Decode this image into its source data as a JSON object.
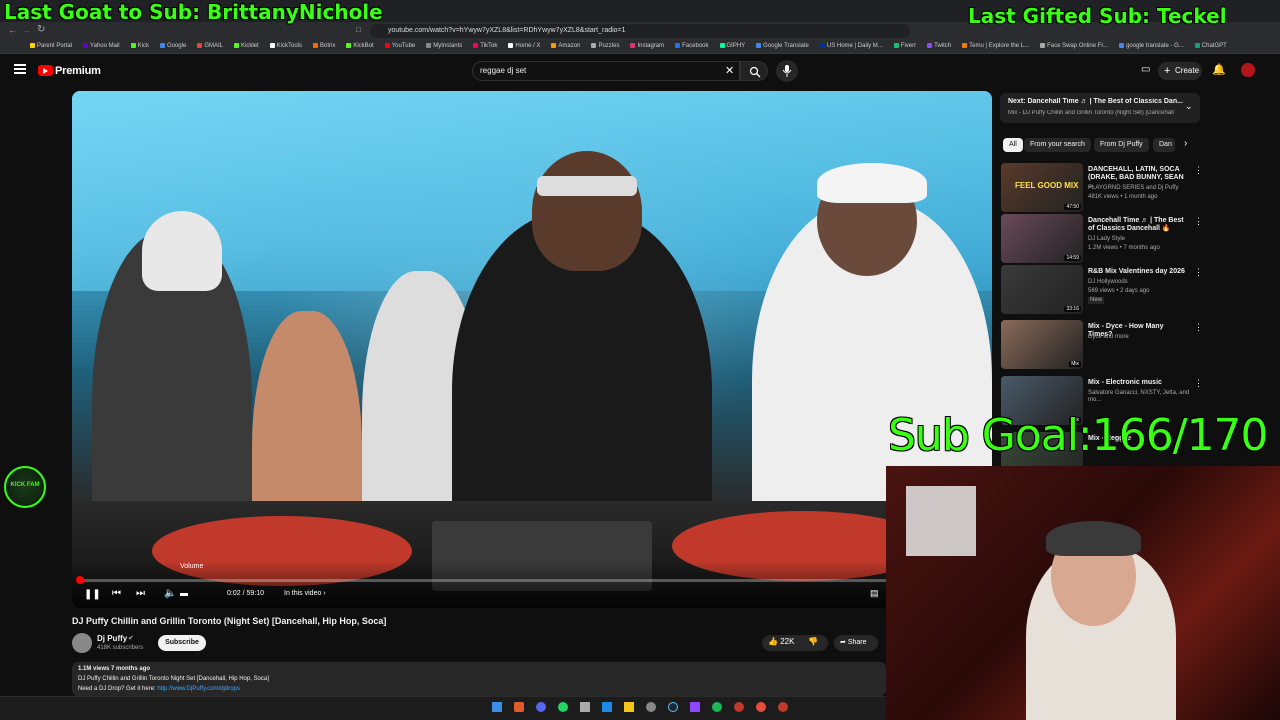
{
  "overlay": {
    "last_goat": "Last Goat to Sub: BrittanyNichole",
    "last_gifted": "Last Gifted Sub: Teckel",
    "sub_goal": "Sub Goal:166/170",
    "kick_badge": "KICK FAM"
  },
  "browser": {
    "url": "youtube.com/watch?v=hYwyw7yXZL8&list=RDhYwyw7yXZL8&start_radio=1",
    "bookmarks": [
      "Parent Portal",
      "Yahoo Mail",
      "Kick",
      "Google",
      "GMAIL",
      "Kicklet",
      "KickTools",
      "Botrix",
      "KickBot",
      "YouTube",
      "MyInstants",
      "TikTok",
      "Home / X",
      "Amazon",
      "Puzzles",
      "Instagram",
      "Facebook",
      "GIPHY",
      "Google Translate",
      "US Home | Daily M...",
      "Fiverr",
      "Twitch",
      "Temu | Explore the L...",
      "Face Swap Online Fr...",
      "google translate - G...",
      "ChatGPT"
    ]
  },
  "header": {
    "logo": "Premium",
    "search_value": "reggae dj set",
    "create_label": "Create"
  },
  "player": {
    "volume_tooltip": "Volume",
    "time": "0:02 / 59:10",
    "chapter": "In this video"
  },
  "video": {
    "title": "DJ Puffy Chillin and Grillin Toronto (Night Set) [Dancehall, Hip Hop, Soca]",
    "channel": "Dj Puffy",
    "subscribers": "418K subscribers",
    "subscribe_label": "Subscribe",
    "likes": "22K",
    "share_label": "Share",
    "stats": "1.1M views  7 months ago",
    "desc_line": "DJ Puffy Chillin and Grillin Toronto Night Set [Dancehall, Hip Hop, Soca]",
    "drop_prefix": "Need a DJ Drop? Get it here:",
    "drop_link": "http://www.DjPuffy.com/djdrops"
  },
  "next": {
    "title": "Next: Dancehall Time ♬ | The Best of Classics Dan...",
    "subtitle": "Mix - DJ Puffy Chillin and Grillin Toronto (Night Set) [Dancehall"
  },
  "chips": [
    "All",
    "From your search",
    "From Dj Puffy",
    "Dan"
  ],
  "recommendations": [
    {
      "title": "DANCEHALL, LATIN, SOCA (DRAKE, BAD BUNNY, SEAN ...",
      "meta1": "PLAYGRND SERIES and Dj Puffy",
      "meta2": "481K views • 1 month ago",
      "duration": "47:50",
      "thumb_text": "FEEL GOOD MIX",
      "color": "#5a3a2a"
    },
    {
      "title": "Dancehall Time ♬ | The Best of Classics Dancehall 🔥",
      "meta1": "DJ Lady Style",
      "meta2": "1.2M views • 7 months ago",
      "duration": "14:59",
      "thumb_text": "",
      "color": "#6a4a5a"
    },
    {
      "title": "R&B Mix Valentines day 2026",
      "meta1": "DJ Hollywoods",
      "meta2": "569 views • 2 days ago",
      "meta3": "New",
      "duration": "33:16",
      "thumb_text": "",
      "color": "#3a3a3a"
    },
    {
      "title": "Mix - Dyce - How Many Times?",
      "meta1": "Dyce and more",
      "meta2": "",
      "duration": "Mix",
      "thumb_text": "",
      "color": "#8a6a5a"
    },
    {
      "title": "Mix - Electronic music",
      "meta1": "Salvatore Ganacci, NXSTY, Jetta, and mo...",
      "meta2": "",
      "duration": "Mix",
      "thumb_text": "",
      "color": "#4a5a6a"
    },
    {
      "title": "Mix - Reggae",
      "meta1": "",
      "meta2": "",
      "duration": "",
      "thumb_text": "",
      "color": "#3a4a3a"
    }
  ]
}
